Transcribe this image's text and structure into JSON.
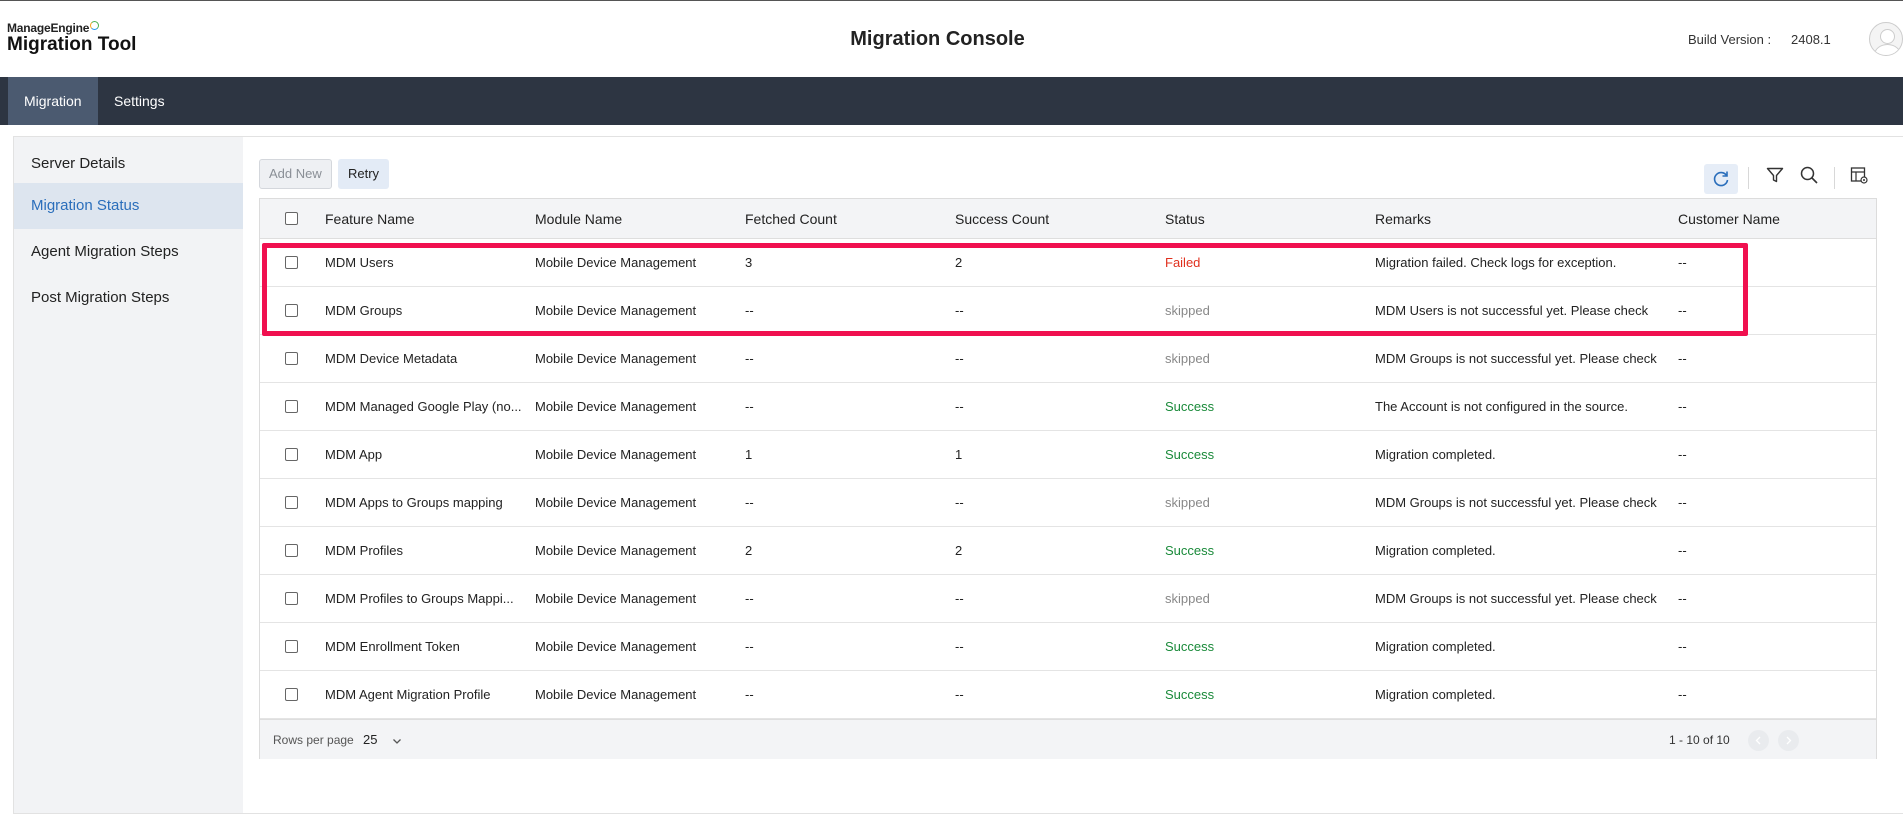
{
  "header": {
    "brand": "ManageEngine",
    "product": "Migration Tool",
    "title": "Migration Console",
    "build_label": "Build Version :",
    "build_value": "2408.1"
  },
  "nav": {
    "tabs": [
      {
        "label": "Migration",
        "active": true
      },
      {
        "label": "Settings",
        "active": false
      }
    ]
  },
  "sidebar": {
    "items": [
      {
        "label": "Server Details",
        "active": false
      },
      {
        "label": "Migration Status",
        "active": true
      },
      {
        "label": "Agent Migration Steps",
        "active": false
      },
      {
        "label": "Post Migration Steps",
        "active": false
      }
    ]
  },
  "toolbar": {
    "add_new_label": "Add New",
    "retry_label": "Retry",
    "icons": [
      "refresh-icon",
      "filter-icon",
      "search-icon",
      "column-settings-icon"
    ]
  },
  "table": {
    "columns": [
      "Feature Name",
      "Module Name",
      "Fetched Count",
      "Success Count",
      "Status",
      "Remarks",
      "Customer Name"
    ],
    "rows": [
      {
        "feature": "MDM Users",
        "module": "Mobile Device Management",
        "fetched": "3",
        "success": "2",
        "status": "Failed",
        "status_type": "failed",
        "remarks": "Migration failed. Check logs for exception.",
        "customer": "--"
      },
      {
        "feature": "MDM Groups",
        "module": "Mobile Device Management",
        "fetched": "--",
        "success": "--",
        "status": "skipped",
        "status_type": "skipped",
        "remarks": "MDM Users is not successful yet. Please check",
        "customer": "--"
      },
      {
        "feature": "MDM Device Metadata",
        "module": "Mobile Device Management",
        "fetched": "--",
        "success": "--",
        "status": "skipped",
        "status_type": "skipped",
        "remarks": "MDM Groups is not successful yet. Please check",
        "customer": "--"
      },
      {
        "feature": "MDM Managed Google Play (no...",
        "module": "Mobile Device Management",
        "fetched": "--",
        "success": "--",
        "status": "Success",
        "status_type": "success",
        "remarks": "The Account is not configured in the source.",
        "customer": "--"
      },
      {
        "feature": "MDM App",
        "module": "Mobile Device Management",
        "fetched": "1",
        "success": "1",
        "status": "Success",
        "status_type": "success",
        "remarks": "Migration completed.",
        "customer": "--"
      },
      {
        "feature": "MDM Apps to Groups mapping",
        "module": "Mobile Device Management",
        "fetched": "--",
        "success": "--",
        "status": "skipped",
        "status_type": "skipped",
        "remarks": "MDM Groups is not successful yet. Please check",
        "customer": "--"
      },
      {
        "feature": "MDM Profiles",
        "module": "Mobile Device Management",
        "fetched": "2",
        "success": "2",
        "status": "Success",
        "status_type": "success",
        "remarks": "Migration completed.",
        "customer": "--"
      },
      {
        "feature": "MDM Profiles to Groups Mappi...",
        "module": "Mobile Device Management",
        "fetched": "--",
        "success": "--",
        "status": "skipped",
        "status_type": "skipped",
        "remarks": "MDM Groups is not successful yet. Please check",
        "customer": "--"
      },
      {
        "feature": "MDM Enrollment Token",
        "module": "Mobile Device Management",
        "fetched": "--",
        "success": "--",
        "status": "Success",
        "status_type": "success",
        "remarks": "Migration completed.",
        "customer": "--"
      },
      {
        "feature": "MDM Agent Migration Profile",
        "module": "Mobile Device Management",
        "fetched": "--",
        "success": "--",
        "status": "Success",
        "status_type": "success",
        "remarks": "Migration completed.",
        "customer": "--"
      }
    ]
  },
  "footer": {
    "rows_per_page_label": "Rows per page",
    "rows_per_page_value": "25",
    "range": "1 - 10 of 10"
  },
  "colors": {
    "nav_bg": "#2d3542",
    "accent": "#2a6ebb",
    "failed": "#e0301e",
    "success": "#1a8a3a",
    "skipped": "#888888",
    "highlight": "#f0104f"
  }
}
